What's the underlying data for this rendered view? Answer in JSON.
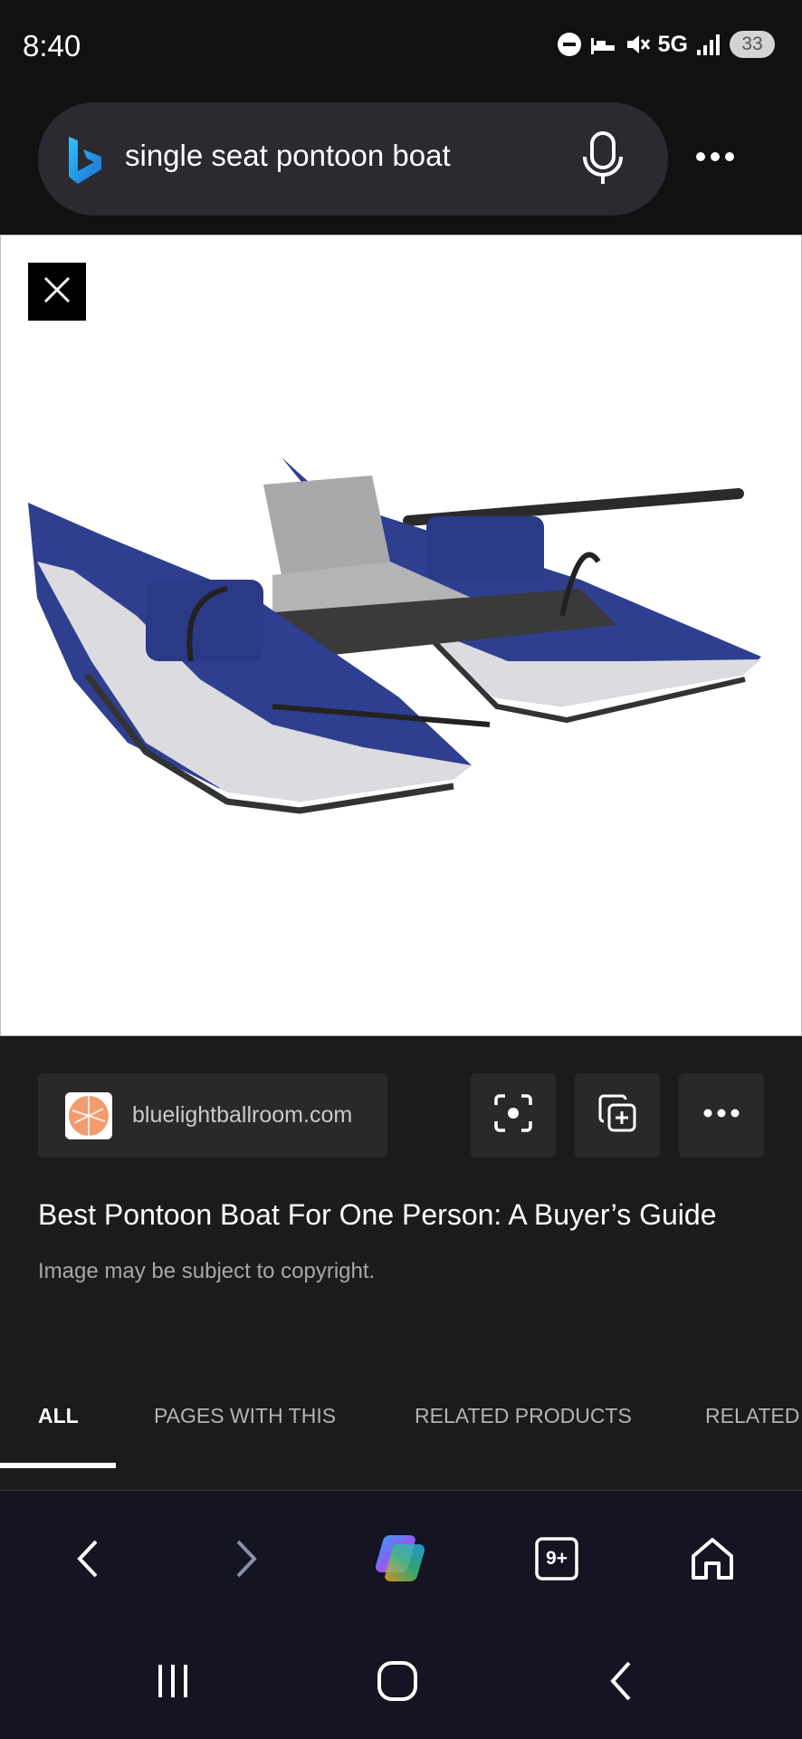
{
  "status_bar": {
    "time": "8:40",
    "network": "5G",
    "battery": "33",
    "icons": [
      "do-not-disturb-icon",
      "sleep-mode-icon",
      "mute-icon",
      "signal-icon"
    ]
  },
  "search": {
    "query": "single seat pontoon boat",
    "logo": "bing-logo",
    "mic_icon": "microphone-icon",
    "more_icon": "more-icon"
  },
  "viewer": {
    "close_icon": "close-icon",
    "image": "pontoon-boat-image"
  },
  "result": {
    "source": "bluelightballroom.com",
    "title": "Best Pontoon Boat For One Person: A Buyer’s Guide",
    "copyright": "Image may be subject to copyright.",
    "actions": [
      "visual-search-icon",
      "copy-add-icon",
      "more-icon"
    ]
  },
  "tabs": [
    {
      "label": "ALL",
      "active": true
    },
    {
      "label": "PAGES WITH THIS",
      "active": false
    },
    {
      "label": "RELATED PRODUCTS",
      "active": false
    },
    {
      "label": "RELATED",
      "active": false
    }
  ],
  "bottom_nav": {
    "back": "back-arrow-icon",
    "forward": "forward-arrow-icon",
    "copilot": "copilot-icon",
    "tabs_count": "9+",
    "home": "home-icon"
  },
  "system_nav": [
    "recents-icon",
    "home-circle-icon",
    "back-icon"
  ],
  "colors": {
    "background": "#1c1a1a",
    "surface": "#2b2828",
    "nav_background": "#141423",
    "boat_blue": "#2e3f8f"
  }
}
